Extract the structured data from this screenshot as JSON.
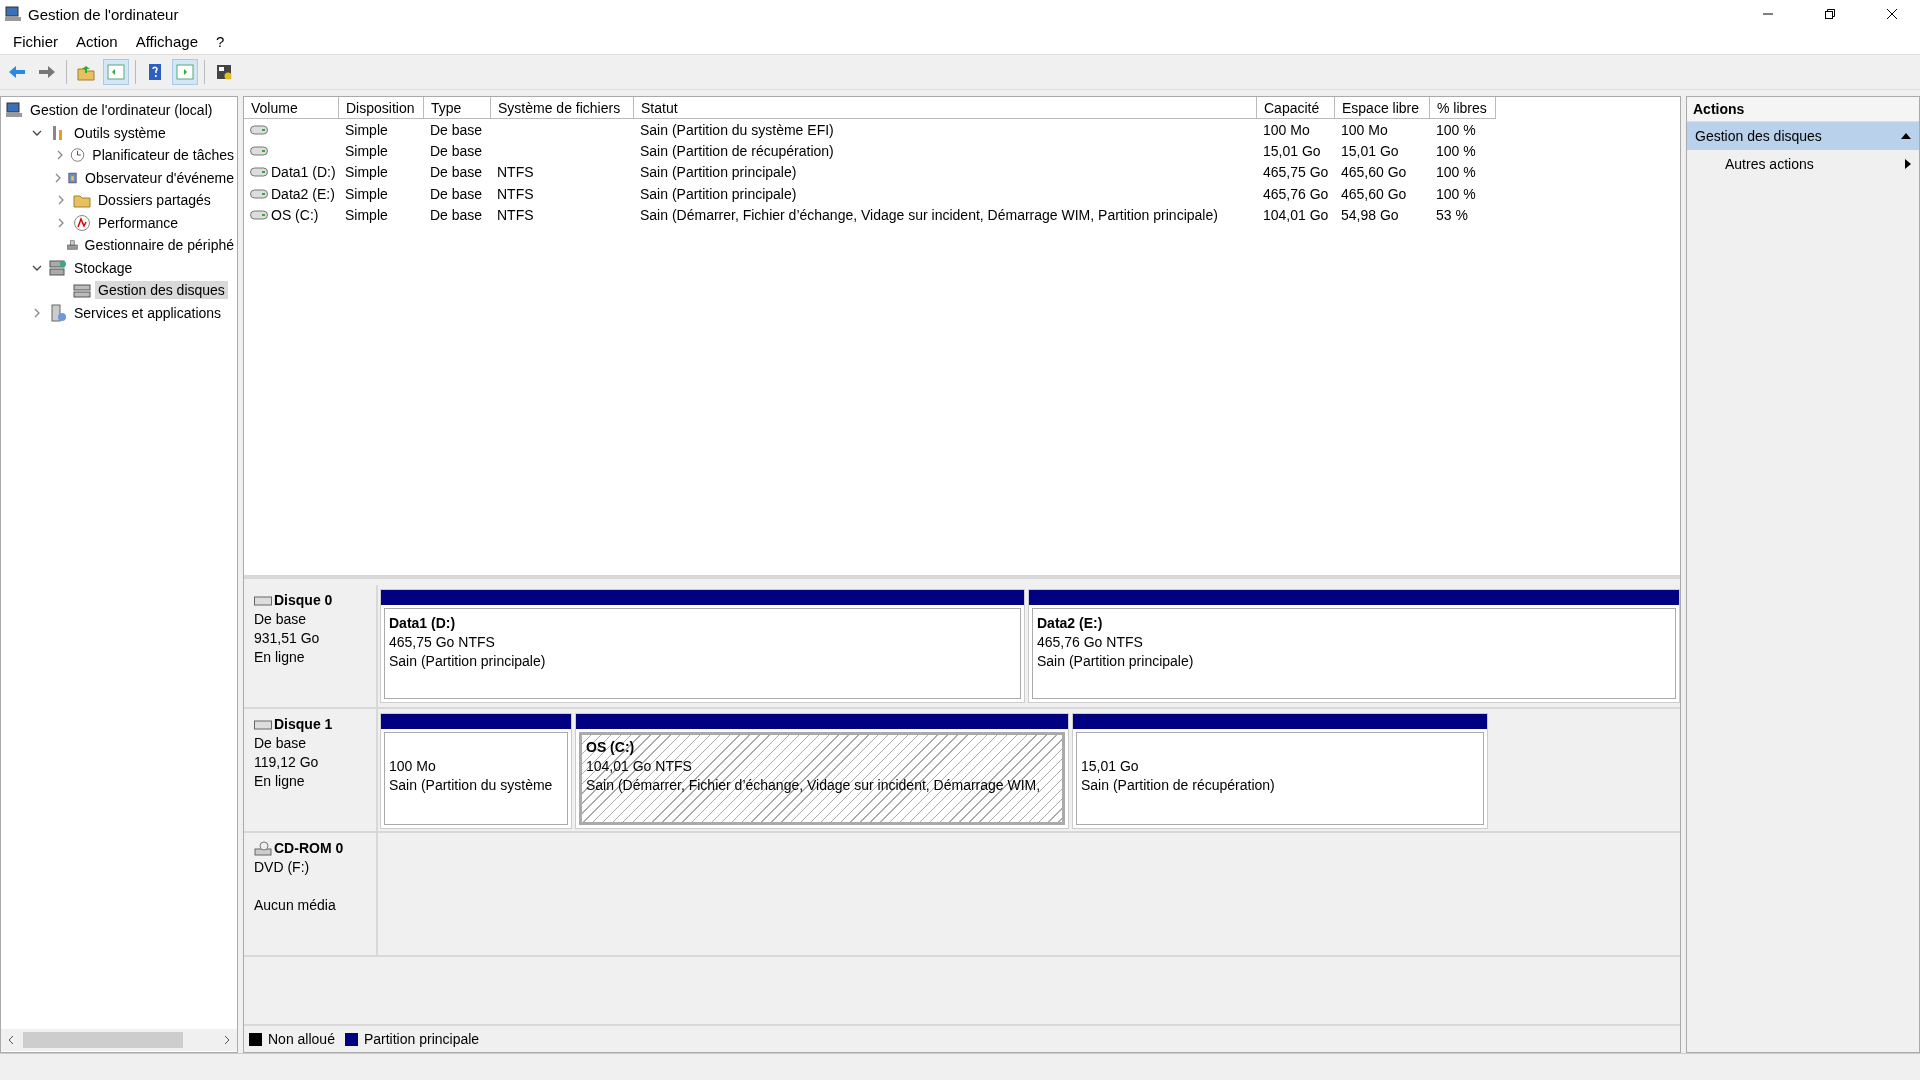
{
  "window": {
    "title": "Gestion de l'ordinateur"
  },
  "menu": [
    "Fichier",
    "Action",
    "Affichage",
    "?"
  ],
  "toolbar": [
    {
      "pressed": false
    },
    {
      "pressed": false
    },
    {
      "pressed": false
    },
    {
      "pressed": true
    },
    {
      "pressed": false
    },
    {
      "pressed": true
    },
    {
      "pressed": false
    }
  ],
  "tree": [
    {
      "label": "Gestion de l'ordinateur (local)",
      "kind": "computer",
      "selected": false,
      "children": [
        {
          "label": "Outils système",
          "kind": "tools",
          "selected": false,
          "expanded": true,
          "children": [
            {
              "label": "Planificateur de tâches",
              "kind": "clock",
              "selected": false,
              "expanded": false
            },
            {
              "label": "Observateur d'événeme",
              "kind": "event",
              "selected": false,
              "expanded": false
            },
            {
              "label": "Dossiers partagés",
              "kind": "share",
              "selected": false,
              "expanded": false
            },
            {
              "label": "Performance",
              "kind": "perf",
              "selected": false,
              "expanded": false
            },
            {
              "label": "Gestionnaire de périphé",
              "kind": "device",
              "selected": false
            }
          ]
        },
        {
          "label": "Stockage",
          "kind": "storage",
          "selected": false,
          "expanded": true,
          "children": [
            {
              "label": "Gestion des disques",
              "kind": "disk",
              "selected": true
            }
          ]
        },
        {
          "label": "Services et applications",
          "kind": "services",
          "selected": false,
          "expanded": false
        }
      ]
    }
  ],
  "table": {
    "columns": [
      "Volume",
      "Disposition",
      "Type",
      "Système de fichiers",
      "Statut",
      "Capacité",
      "Espace libre",
      "% libres"
    ],
    "rows": [
      {
        "disposition": "Simple",
        "type": "De base",
        "status": "Sain (Partition du système EFI)",
        "capacity": "100 Mo",
        "free": "100 Mo",
        "percent": "100 %"
      },
      {
        "disposition": "Simple",
        "type": "De base",
        "status": "Sain (Partition de récupération)",
        "capacity": "15,01 Go",
        "free": "15,01 Go",
        "percent": "100 %"
      },
      {
        "volume": "Data1 (D:)",
        "disposition": "Simple",
        "type": "De base",
        "filesystem": "NTFS",
        "status": "Sain (Partition principale)",
        "capacity": "465,75 Go",
        "free": "465,60 Go",
        "percent": "100 %"
      },
      {
        "volume": "Data2 (E:)",
        "disposition": "Simple",
        "type": "De base",
        "filesystem": "NTFS",
        "status": "Sain (Partition principale)",
        "capacity": "465,76 Go",
        "free": "465,60 Go",
        "percent": "100 %"
      },
      {
        "volume": "OS (C:)",
        "disposition": "Simple",
        "type": "De base",
        "filesystem": "NTFS",
        "status": "Sain (Démarrer, Fichier d’échange, Vidage sur incident, Démarrage WIM, Partition principale)",
        "capacity": "104,01 Go",
        "free": "54,98 Go",
        "percent": "53 %"
      }
    ]
  },
  "disks": [
    {
      "name": "Disque 0",
      "kind": "disk",
      "lines": [
        "De base",
        "931,51 Go",
        "En ligne"
      ],
      "partitions": [
        {
          "title": "Data1  (D:)",
          "size": "465,75 Go NTFS",
          "status": "Sain (Partition principale)",
          "selected": false
        },
        {
          "title": "Data2  (E:)",
          "size": "465,76 Go NTFS",
          "status": "Sain (Partition principale)",
          "selected": false
        }
      ]
    },
    {
      "name": "Disque 1",
      "kind": "disk",
      "lines": [
        "De base",
        "119,12 Go",
        "En ligne"
      ],
      "partitions": [
        {
          "size": "100 Mo",
          "status": "Sain (Partition du système",
          "selected": false
        },
        {
          "title": "OS  (C:)",
          "size": "104,01 Go NTFS",
          "status": "Sain (Démarrer, Fichier d’échange, Vidage sur incident, Démarrage WIM,",
          "selected": true
        },
        {
          "size": "15,01 Go",
          "status": "Sain (Partition de récupération)",
          "selected": false
        }
      ]
    },
    {
      "name": "CD-ROM 0",
      "kind": "cdrom",
      "lines": [
        "DVD (F:)",
        "Aucun média"
      ]
    }
  ],
  "legend": [
    {
      "label": "Non alloué",
      "color": "#000000"
    },
    {
      "label": "Partition principale",
      "color": "#000080"
    }
  ],
  "actions": {
    "title": "Actions",
    "section": {
      "label": "Gestion des disques",
      "expanded": true
    },
    "items": [
      "Autres actions"
    ]
  }
}
